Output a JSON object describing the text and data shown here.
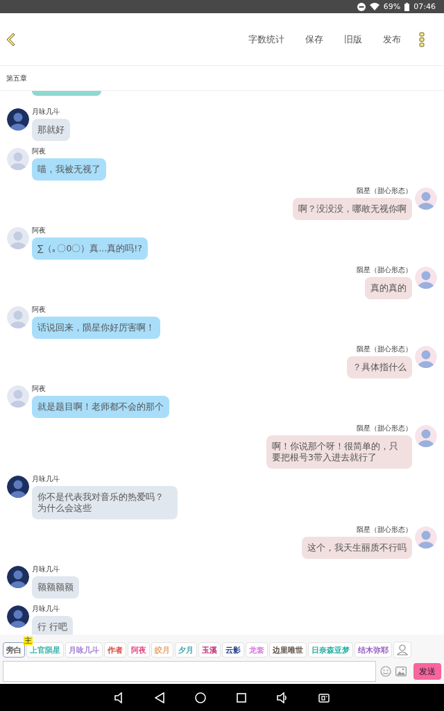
{
  "status_bar": {
    "battery": "69%",
    "time": "07:46"
  },
  "toolbar": {
    "actions": [
      "字数统计",
      "保存",
      "旧版",
      "发布"
    ]
  },
  "chapter": "第五章",
  "chat": {
    "cut_bubble": {
      "color": "#8dd8d0"
    },
    "messages": [
      {
        "outgoing": false,
        "avatar": {
          "kind": "dark"
        },
        "name": "月咏几斗",
        "text": "那就好",
        "color": "#e1e7ef"
      },
      {
        "outgoing": false,
        "avatar": {
          "kind": "placeholder"
        },
        "name": "阿夜",
        "text": "喵，我被无视了",
        "color": "#a8defa"
      },
      {
        "outgoing": true,
        "avatar": {
          "kind": "light"
        },
        "name": "陨星（甜心形态）",
        "text": "啊？没没没，哪敢无视你啊",
        "color": "#f2e0e0"
      },
      {
        "outgoing": false,
        "avatar": {
          "kind": "placeholder"
        },
        "name": "阿夜",
        "text": "∑（｡〇0〇）真...真的吗!?",
        "color": "#a8defa"
      },
      {
        "outgoing": true,
        "avatar": {
          "kind": "light"
        },
        "name": "陨星（甜心形态）",
        "text": "真的真的",
        "color": "#f2e0e0"
      },
      {
        "outgoing": false,
        "avatar": {
          "kind": "placeholder"
        },
        "name": "阿夜",
        "text": "话说回来，陨星你好厉害啊！",
        "color": "#a8defa"
      },
      {
        "outgoing": true,
        "avatar": {
          "kind": "light"
        },
        "name": "陨星（甜心形态）",
        "text": "？具体指什么",
        "color": "#f2e0e0"
      },
      {
        "outgoing": false,
        "avatar": {
          "kind": "placeholder"
        },
        "name": "阿夜",
        "text": "就是题目啊！老师都不会的那个",
        "color": "#a8defa"
      },
      {
        "outgoing": true,
        "avatar": {
          "kind": "light"
        },
        "name": "陨星（甜心形态）",
        "text": "啊！你说那个呀！很简单的，只要把根号3带入进去就行了",
        "color": "#f2e0e0"
      },
      {
        "outgoing": false,
        "avatar": {
          "kind": "dark"
        },
        "name": "月咏几斗",
        "text": "你不是代表我对音乐的热爱吗？为什么会这些",
        "color": "#e1e7ef"
      },
      {
        "outgoing": true,
        "avatar": {
          "kind": "light"
        },
        "name": "陨星（甜心形态）",
        "text": "这个，我天生丽质不行吗",
        "color": "#f2e0e0"
      },
      {
        "outgoing": false,
        "avatar": {
          "kind": "dark"
        },
        "name": "月咏几斗",
        "text": "额额额额",
        "color": "#e1e7ef"
      },
      {
        "outgoing": false,
        "avatar": {
          "kind": "dark"
        },
        "name": "月咏几斗",
        "text": "行 行吧",
        "color": "#e1e7ef"
      }
    ]
  },
  "composer": {
    "roles": [
      {
        "label": "旁白",
        "color": "#555555",
        "selected": true
      },
      {
        "label": "上官陨星",
        "color": "#38b6ac",
        "selected": false,
        "badge": "主"
      },
      {
        "label": "月咏几斗",
        "color": "#a47ed0",
        "selected": false
      },
      {
        "label": "作者",
        "color": "#d9463e",
        "selected": false
      },
      {
        "label": "阿夜",
        "color": "#e04f86",
        "selected": false
      },
      {
        "label": "皎月",
        "color": "#e8a26e",
        "selected": false
      },
      {
        "label": "夕月",
        "color": "#4aa6b0",
        "selected": false
      },
      {
        "label": "玉溪",
        "color": "#c02f78",
        "selected": false
      },
      {
        "label": "云影",
        "color": "#203c88",
        "selected": false
      },
      {
        "label": "龙套",
        "color": "#de78e0",
        "selected": false
      },
      {
        "label": "边里唯世",
        "color": "#5a4a3e",
        "selected": false
      },
      {
        "label": "日奈森亚梦",
        "color": "#26b0a2",
        "selected": false
      },
      {
        "label": "结木弥耶",
        "color": "#9a62c2",
        "selected": false
      }
    ],
    "send": "发送"
  }
}
